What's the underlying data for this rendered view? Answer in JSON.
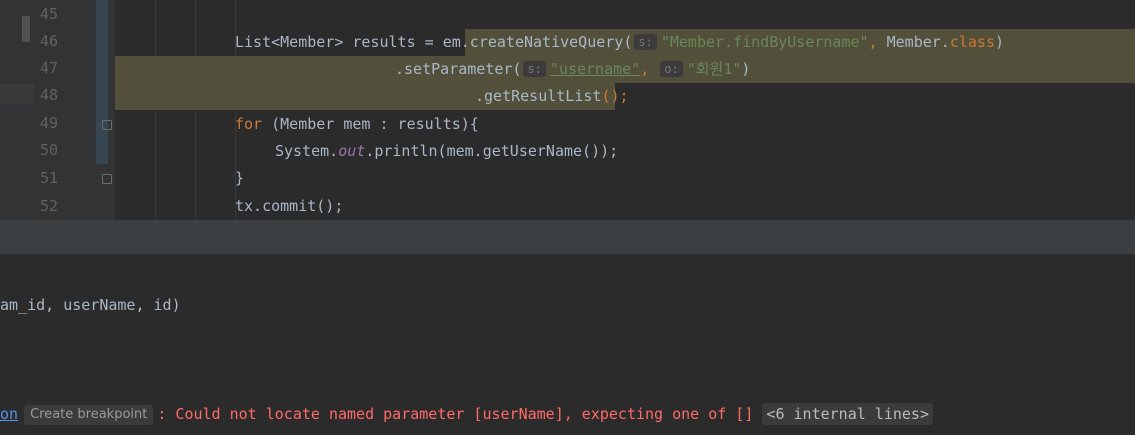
{
  "editor": {
    "line_numbers": [
      "45",
      "46",
      "47",
      "48",
      "49",
      "50",
      "51",
      "52"
    ],
    "lines": {
      "l46": {
        "part1": "List<Member> results = ",
        "part2": "em.createNativeQuery(",
        "hint": "s:",
        "str": "\"Member.findByUsername\"",
        "comma": ", ",
        "cls": "Member.",
        "class_kw": "class",
        "close": ")"
      },
      "l47": {
        "call": ".setParameter(",
        "hint1": "s:",
        "str1": "\"username\"",
        "comma": ", ",
        "hint2": "o:",
        "str2": "\"회원1\"",
        "close": ")"
      },
      "l48": {
        "call": ".getResultList",
        "close": "();"
      },
      "l49": {
        "kw": "for",
        "rest": " (Member mem : results){"
      },
      "l50": {
        "pre": "System.",
        "out": "out",
        "post": ".println(mem.getUserName());"
      },
      "l51": {
        "text": "}"
      },
      "l52": {
        "text": "tx.commit();"
      }
    }
  },
  "console": {
    "line1": "am_id, userName, id)",
    "line2": {
      "link": "on",
      "breakpoint_button": "Create breakpoint",
      "error": ": Could not locate named parameter [userName], expecting one of []",
      "internal": "<6 internal lines>"
    }
  }
}
